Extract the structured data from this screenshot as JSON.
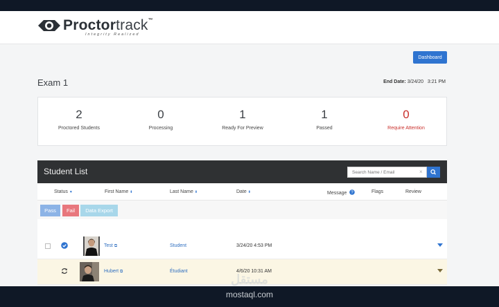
{
  "brand": {
    "name_bold": "Proctor",
    "name_light": "track",
    "tm": "™",
    "tagline": "Integrity Realized"
  },
  "toolbar": {
    "dashboard_label": "Dashboard"
  },
  "exam": {
    "title": "Exam 1",
    "end_date_label": "End Date:",
    "end_date_value": "3/24/20",
    "end_time": "3:21 PM"
  },
  "stats": [
    {
      "value": "2",
      "label": "Proctored Students"
    },
    {
      "value": "0",
      "label": "Processing"
    },
    {
      "value": "1",
      "label": "Ready For Preview"
    },
    {
      "value": "1",
      "label": "Passed"
    },
    {
      "value": "0",
      "label": "Require Attention"
    }
  ],
  "student_list": {
    "title": "Student List",
    "search_placeholder": "Search Name / Email",
    "search_clear": "×",
    "columns": {
      "status": "Status",
      "first_name": "First Name",
      "last_name": "Last Name",
      "date": "Date",
      "message": "Message",
      "flags": "Flags",
      "review": "Review"
    },
    "actions": {
      "pass": "Pass",
      "fail": "Fail",
      "export": "Data Export"
    },
    "rows": [
      {
        "first_name": "Test",
        "last_name": "Student",
        "date": "3/24/20 4:53 PM",
        "status_icon": "check-circle-icon"
      },
      {
        "first_name": "Hubert",
        "last_name": "Étudiant",
        "date": "4/6/20 10:31 AM",
        "status_icon": "refresh-icon"
      }
    ]
  },
  "watermark": {
    "arabic": "مستقل",
    "url": "mostaql.com"
  },
  "colors": {
    "primary": "#2f74d0",
    "danger": "#c9302c",
    "header_dark": "#2f3133",
    "highlight_row": "#fbf6e4"
  }
}
